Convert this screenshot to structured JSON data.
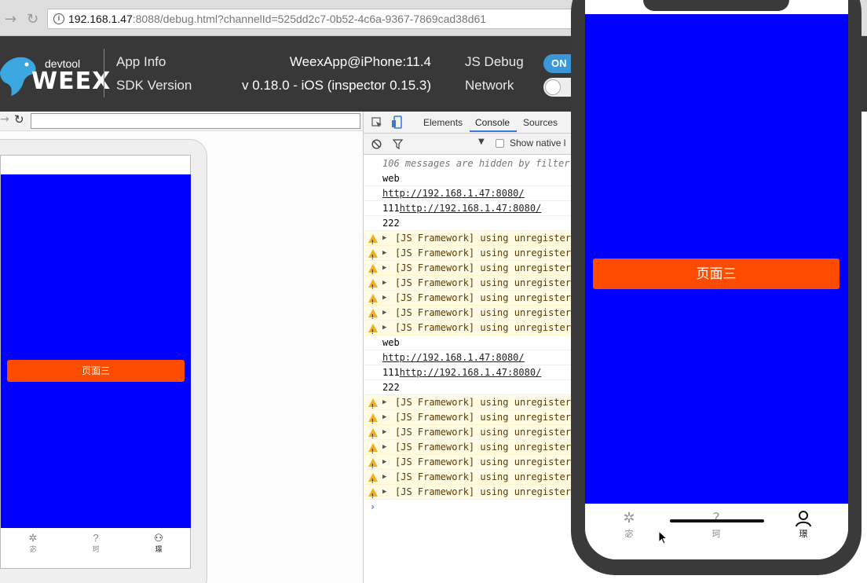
{
  "browser": {
    "url_host": "192.168.1.47",
    "url_rest": ":8088/debug.html?channelId=525dd2c7-0b52-4c6a-9367-7869cad38d61"
  },
  "devtool_header": {
    "logo_small": "devtool",
    "logo_big": "WEEX",
    "app_info_label": "App Info",
    "app_info_value": "WeexApp@iPhone:11.4",
    "sdk_label": "SDK Version",
    "sdk_value": "v 0.18.0 - iOS (inspector 0.15.3)",
    "js_debug_label": "JS Debug",
    "js_debug_state": "ON",
    "network_label": "Network"
  },
  "devtools": {
    "tabs": [
      "Elements",
      "Console",
      "Sources"
    ],
    "active_tab": "Console",
    "show_native_label": "Show native l",
    "hidden_msg": "106 messages are hidden by filter",
    "logs": [
      {
        "type": "log",
        "text": "web"
      },
      {
        "type": "link",
        "text": "http://192.168.1.47:8080/"
      },
      {
        "type": "prefixlink",
        "prefix": "111",
        "text": "http://192.168.1.47:8080/"
      },
      {
        "type": "log",
        "text": "222"
      },
      {
        "type": "warn",
        "text": "[JS Framework] using unregistere"
      },
      {
        "type": "warn",
        "text": "[JS Framework] using unregistere"
      },
      {
        "type": "warn",
        "text": "[JS Framework] using unregistere"
      },
      {
        "type": "warn",
        "text": "[JS Framework] using unregistere"
      },
      {
        "type": "warn",
        "text": "[JS Framework] using unregistere"
      },
      {
        "type": "warn",
        "text": "[JS Framework] using unregistere"
      },
      {
        "type": "warn",
        "text": "[JS Framework] using unregistere"
      },
      {
        "type": "log",
        "text": "web"
      },
      {
        "type": "link",
        "text": "http://192.168.1.47:8080/"
      },
      {
        "type": "prefixlink",
        "prefix": "111",
        "text": "http://192.168.1.47:8080/"
      },
      {
        "type": "log",
        "text": "222"
      },
      {
        "type": "warn",
        "text": "[JS Framework] using unregistere"
      },
      {
        "type": "warn",
        "text": "[JS Framework] using unregistere"
      },
      {
        "type": "warn",
        "text": "[JS Framework] using unregistere"
      },
      {
        "type": "warn",
        "text": "[JS Framework] using unregistere"
      },
      {
        "type": "warn",
        "text": "[JS Framework] using unregistere"
      },
      {
        "type": "warn",
        "text": "[JS Framework] using unregistere"
      },
      {
        "type": "warn",
        "text": "[JS Framework] using unregistere"
      }
    ],
    "prompt": "›"
  },
  "preview": {
    "button_label": "页面三",
    "tabs": [
      {
        "label": "宓",
        "icon": "aperture-icon"
      },
      {
        "label": "珂",
        "icon": "question-icon"
      },
      {
        "label": "璟",
        "icon": "user-icon"
      }
    ],
    "active_tab": 2
  },
  "colors": {
    "blue_page": "#0000ff",
    "orange_button": "#ff4b00",
    "toggle_on": "#3c97d8"
  }
}
